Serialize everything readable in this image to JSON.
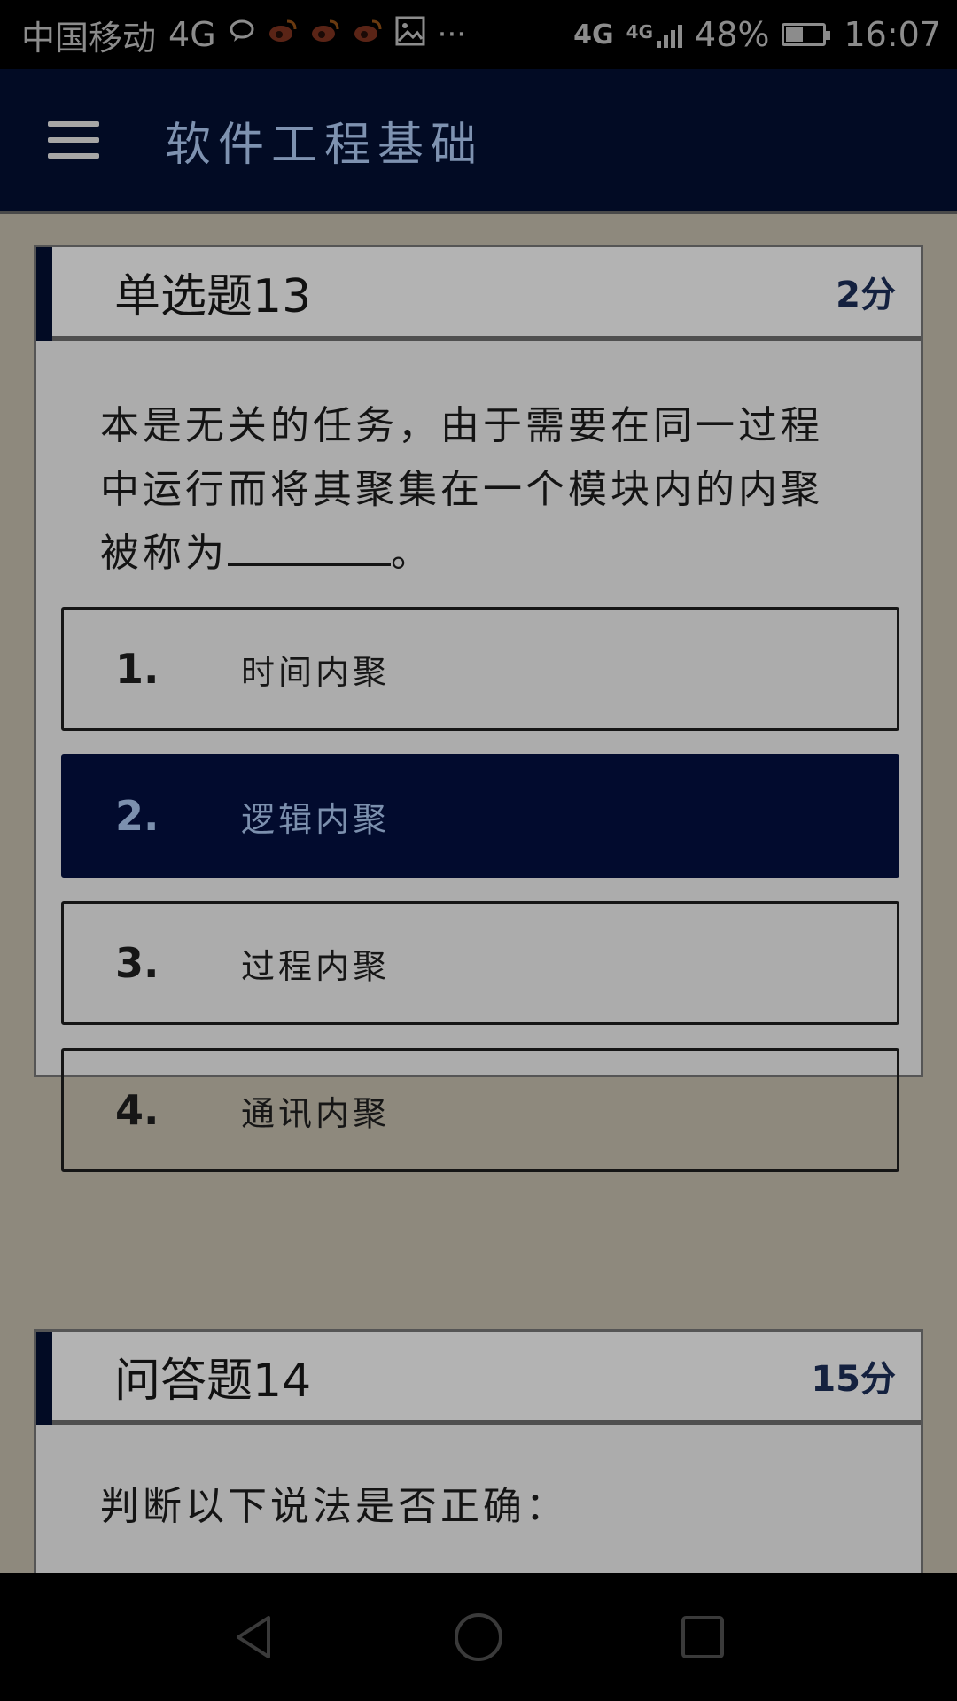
{
  "status_bar": {
    "carrier": "中国移动",
    "network": "4G",
    "network_right": "4G",
    "network_small": "4G",
    "battery_percent": "48%",
    "battery_level": 0.48,
    "time": "16:07",
    "more_glyph": "···",
    "icons": [
      "chat-bubble-icon",
      "weibo-icon",
      "weibo-icon",
      "weibo-icon",
      "image-icon"
    ]
  },
  "app_bar": {
    "title": "软件工程基础"
  },
  "questions": [
    {
      "title": "单选题13",
      "score": "2分",
      "text": "本是无关的任务，由于需要在同一过程中运行而将其聚集在一个模块内的内聚被称为",
      "text_suffix": "。",
      "options": [
        {
          "num": "1.",
          "text": "时间内聚",
          "selected": false
        },
        {
          "num": "2.",
          "text": "逻辑内聚",
          "selected": true
        },
        {
          "num": "3.",
          "text": "过程内聚",
          "selected": false
        },
        {
          "num": "4.",
          "text": "通讯内聚",
          "selected": false
        }
      ]
    },
    {
      "title": "问答题14",
      "score": "15分",
      "text": "判断以下说法是否正确："
    }
  ],
  "colors": {
    "app_bar": "#020b24",
    "selected_option": "#020b2e",
    "background": "#8e897d",
    "card": "#acacac"
  }
}
